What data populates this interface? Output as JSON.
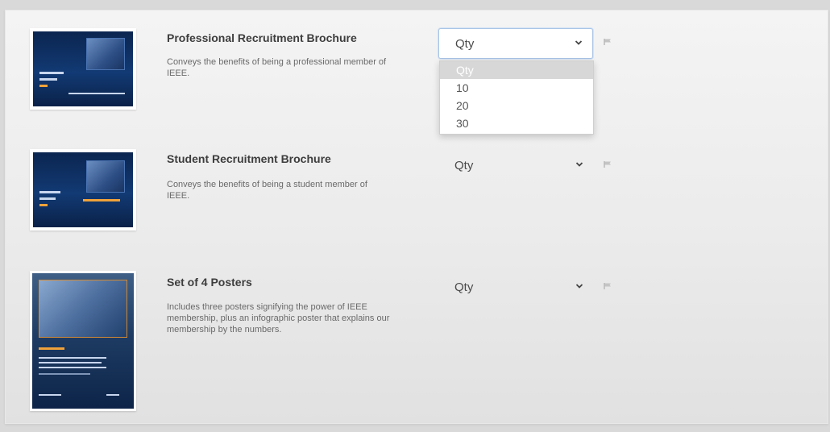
{
  "products": [
    {
      "title": "Professional Recruitment Brochure",
      "description": "Conveys the benefits of being a professional member of IEEE.",
      "qty_label": "Qty"
    },
    {
      "title": "Student Recruitment Brochure",
      "description": "Conveys the benefits of being a student member of IEEE.",
      "qty_label": "Qty"
    },
    {
      "title": "Set of 4 Posters",
      "description": "Includes three posters signifying the power of IEEE membership, plus an infographic poster that explains our membership by the numbers.",
      "qty_label": "Qty"
    }
  ],
  "qty_dropdown": {
    "options": [
      "Qty",
      "10",
      "20",
      "30"
    ],
    "selected": "Qty"
  },
  "colors": {
    "focus_border": "#a9c4e6",
    "cover_navy": "#0b2550",
    "accent_orange": "#f0a23a"
  }
}
